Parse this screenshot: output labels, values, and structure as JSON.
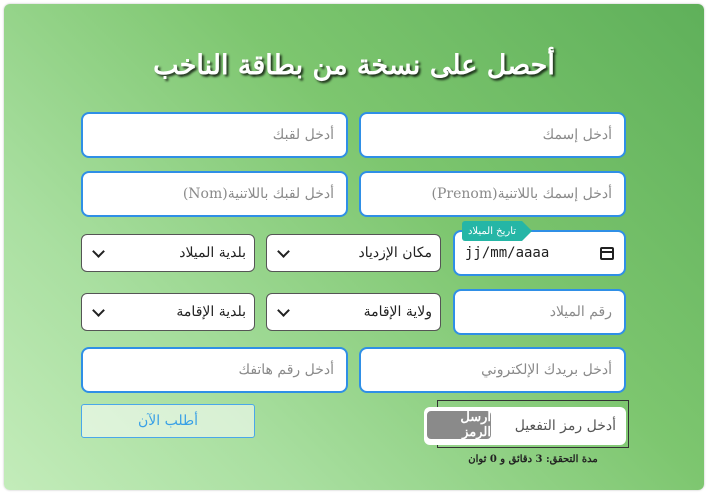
{
  "form": {
    "title": "أحصل على نسخة من بطاقة الناخب",
    "first_name_placeholder": "أدخل إسمك",
    "last_name_placeholder": "أدخل لقبك",
    "first_name_latin_placeholder": "أدخل إسمك باللاتنية(Prenom)",
    "last_name_latin_placeholder": "أدخل لقبك باللاتنية(Nom)",
    "birth_date_tag": "تاريخ الميلاد",
    "birth_date_value": "jj/mm/aaaa",
    "birth_place_select": "مكان الإزدياد",
    "birth_municipality_select": "بلدية الميلاد",
    "birth_number_placeholder": "رقم الميلاد",
    "residence_state_select": "ولاية الإقامة",
    "residence_municipality_select": "بلدية الإقامة",
    "email_placeholder": "أدخل بريدك الإلكتروني",
    "phone_placeholder": "أدخل رقم هاتفك",
    "activation_code_placeholder": "أدخل رمز التفعيل",
    "send_code_button": "أرسل الرمز",
    "timer_text": "مدة التحقق: 3 دقائق و 0 ثوان",
    "submit_button": "أطلب الآن"
  },
  "colors": {
    "accent_border": "#2f8fe6",
    "tag": "#25b6a6",
    "send_button": "#8a8a8a",
    "submit_text": "#38a0e6"
  },
  "icons": {
    "calendar": "calendar-icon",
    "chevron": "chevron-down-icon"
  }
}
